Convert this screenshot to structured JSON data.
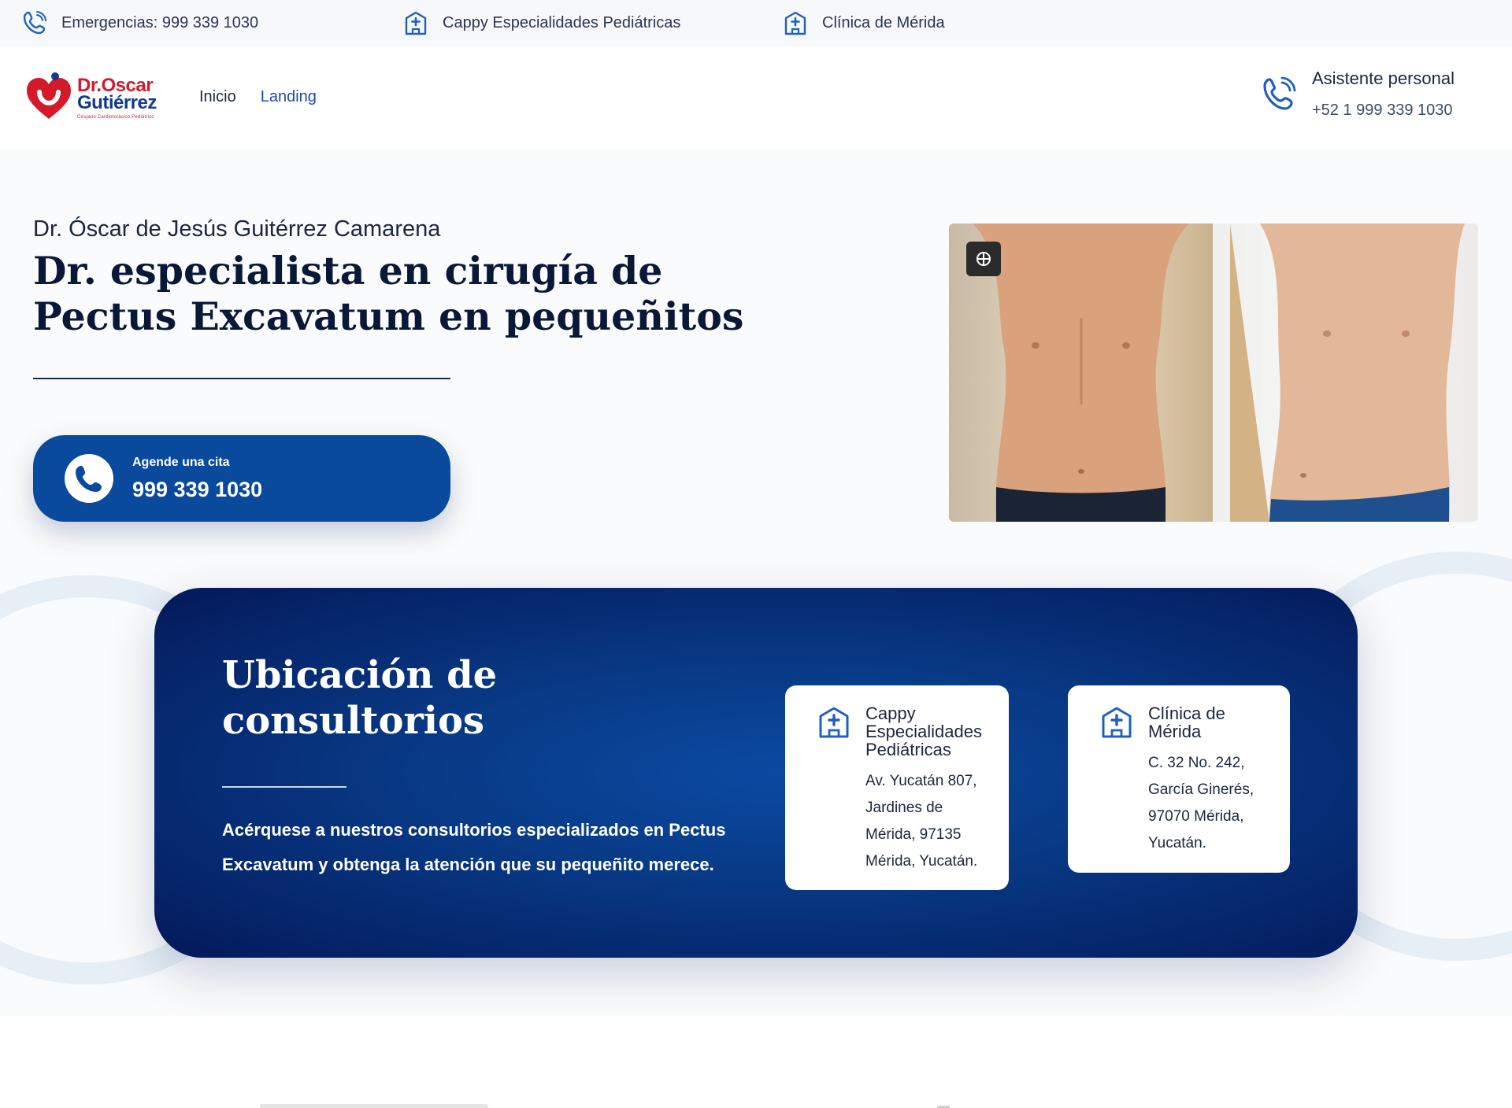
{
  "topbar": {
    "emergency": "Emergencias: 999 339 1030",
    "location_1": "Cappy Especialidades Pediátricas",
    "location_2": "Clínica de Mérida"
  },
  "header": {
    "logo": {
      "line1": "Dr.Oscar",
      "line2": "Gutiérrez",
      "tagline": "Cirujano Cardiotorácico Pediátrico"
    },
    "nav": [
      "Inicio",
      "Landing"
    ],
    "assistant_title": "Asistente personal",
    "assistant_phone": "+52 1 999 339 1030"
  },
  "hero": {
    "subtitle": "Dr. Óscar de Jesús Guitérrez Camarena",
    "headline": "Dr. especialista en cirugía de Pectus Excavatum en pequeñitos",
    "cta_label": "Agende una cita",
    "cta_phone": "999 339 1030"
  },
  "locations": {
    "title": "Ubicación de consultorios",
    "description": "Acérquese a nuestros consultorios especializados en Pectus Excavatum y obtenga la atención que su pequeñito merece.",
    "cards": [
      {
        "title_lines": [
          "Cappy",
          "Especialidades",
          "Pediátricas"
        ],
        "address_lines": [
          "Av. Yucatán 807,",
          "Jardines de",
          "Mérida, 97135",
          "Mérida, Yucatán."
        ]
      },
      {
        "title_lines": [
          "Clínica de",
          "Mérida"
        ],
        "address_lines": [
          "C. 32 No. 242,",
          "García Ginerés,",
          "97070 Mérida,",
          "Yucatán."
        ]
      }
    ]
  },
  "colors": {
    "brand_blue": "#0a4a9c",
    "brand_red": "#d4192a",
    "panel_dark": "#04195a"
  }
}
